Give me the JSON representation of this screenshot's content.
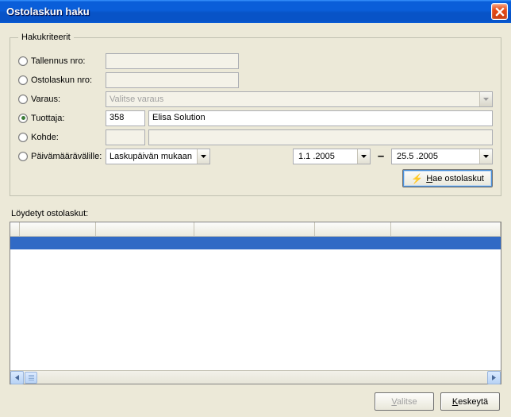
{
  "window": {
    "title": "Ostolaskun haku"
  },
  "criteria": {
    "legend": "Hakukriteerit",
    "tallennus_label": "Tallennus nro:",
    "ostolaskun_label": "Ostolaskun nro:",
    "varaus_label": "Varaus:",
    "varaus_placeholder": "Valitse varaus",
    "tuottaja_label": "Tuottaja:",
    "tuottaja_code": "358",
    "tuottaja_name": "Elisa Solution",
    "kohde_label": "Kohde:",
    "pvm_label": "Päivämäärävälille:",
    "datemode": "Laskupäivän mukaan",
    "date_from": "1.1 .2005",
    "date_to": "25.5 .2005",
    "selected": "tuottaja"
  },
  "actions": {
    "hae_prefix": "H",
    "hae_rest": "ae ostolaskut"
  },
  "results": {
    "label": "Löydetyt ostolaskut:"
  },
  "footer": {
    "valitse_prefix": "V",
    "valitse_rest": "alitse",
    "keskeyta_prefix": "K",
    "keskeyta_rest": "eskeytä"
  }
}
